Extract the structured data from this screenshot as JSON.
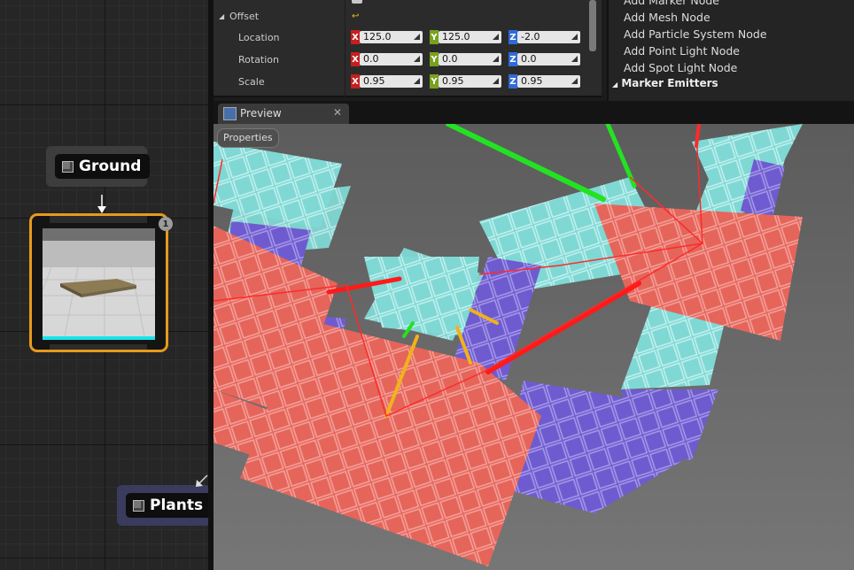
{
  "graph": {
    "nodes": [
      {
        "label": "Ground"
      },
      {
        "label": "Plants"
      }
    ],
    "thumbnail_badge": "1"
  },
  "details": {
    "offset_label": "Offset",
    "rows": [
      {
        "label": "Location",
        "x": "125.0",
        "y": "125.0",
        "z": "-2.0"
      },
      {
        "label": "Rotation",
        "x": "0.0",
        "y": "0.0",
        "z": "0.0"
      },
      {
        "label": "Scale",
        "x": "0.95",
        "y": "0.95",
        "z": "0.95"
      }
    ],
    "axis_labels": {
      "x": "X",
      "y": "Y",
      "z": "Z"
    }
  },
  "palette": {
    "items": [
      "Add Marker Node",
      "Add Mesh Node",
      "Add Particle System Node",
      "Add Point Light Node",
      "Add Spot Light Node"
    ],
    "category": "Marker Emitters"
  },
  "preview": {
    "tab_label": "Preview",
    "close_glyph": "✕",
    "properties_button": "Properties"
  },
  "colors": {
    "selection_orange": "#e79a1b",
    "tile_red": "#e5655b",
    "tile_cyan": "#7fd8d4",
    "tile_blue": "#6e5bcf",
    "axis_x": "#c61f1f",
    "axis_y": "#78a21c",
    "axis_z": "#2f6bd8"
  },
  "icons": {
    "node": "cube-icon",
    "tab": "preview-viewport-icon",
    "reset": "reset-arrow-icon"
  }
}
